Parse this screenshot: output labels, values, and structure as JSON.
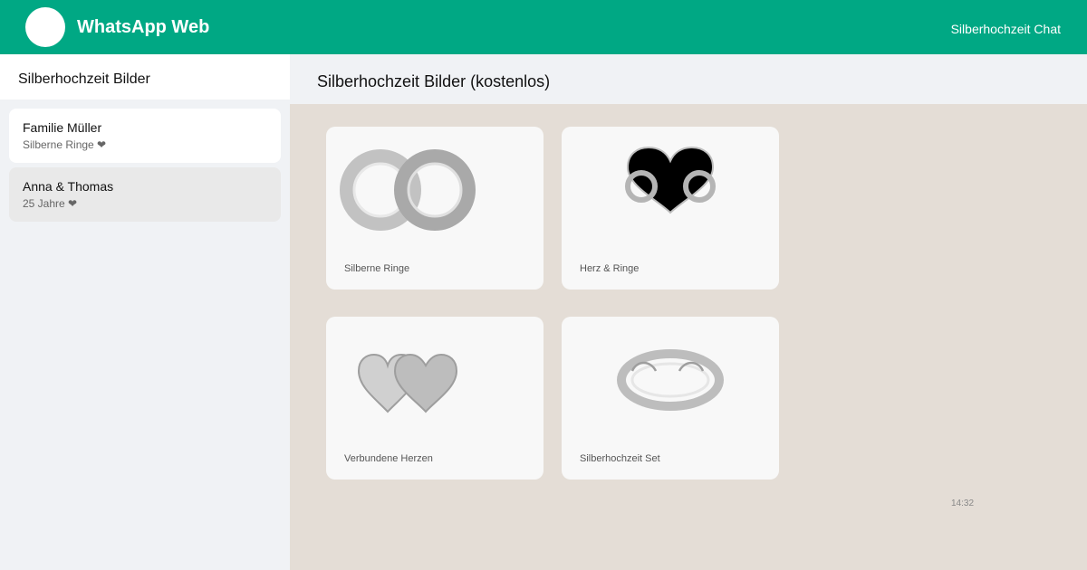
{
  "app": {
    "title": "WhatsApp Web",
    "header_right": "Silberhochzeit Chat"
  },
  "sidebar": {
    "title": "Silberhochzeit Bilder",
    "chats": [
      {
        "name": "Familie Müller",
        "preview": "Silberne Ringe ❤"
      },
      {
        "name": "Anna & Thomas",
        "preview": "25 Jahre ❤"
      }
    ]
  },
  "main": {
    "title": "Silberhochzeit Bilder (kostenlos)",
    "images": [
      {
        "label": "Silberne Ringe",
        "icon": "silver-rings-icon"
      },
      {
        "label": "Herz & Ringe",
        "icon": "heart-rings-icon"
      },
      {
        "label": "Verbundene Herzen",
        "icon": "connected-hearts-icon"
      },
      {
        "label": "Silberhochzeit Set",
        "icon": "silver-set-icon"
      }
    ],
    "timestamp": "14:32"
  },
  "colors": {
    "brand_green": "#00a884",
    "chat_background": "#e4ddd6",
    "panel_background": "#f0f2f5",
    "silver": "#b0b0b0"
  }
}
